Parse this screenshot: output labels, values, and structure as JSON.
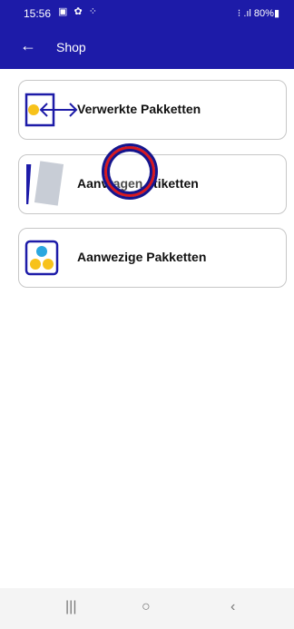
{
  "status_bar": {
    "time": "15:56",
    "left_icons": "▣ ✿ ⁘",
    "right_text": "⁝ .ıl 80%▮"
  },
  "app_bar": {
    "title": "Shop",
    "back_icon": "←"
  },
  "menu": [
    {
      "label": "Verwerkte Pakketten",
      "icon": "transfer-icon"
    },
    {
      "label": "Aanvragen etiketten",
      "icon": "labels-icon"
    },
    {
      "label": "Aanwezige Pakketten",
      "icon": "packages-icon"
    }
  ],
  "nav_bar": {
    "recent": "|||",
    "home": "○",
    "back": "‹"
  },
  "colors": {
    "primary": "#1d1ba8",
    "accent_yellow": "#f7c21b",
    "accent_blue": "#2aa7df",
    "annotation_red": "#d71920"
  }
}
